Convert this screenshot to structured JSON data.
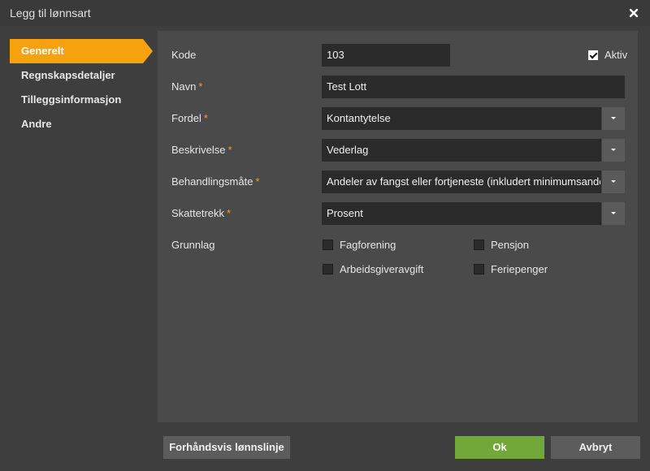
{
  "dialog": {
    "title": "Legg til lønnsart"
  },
  "sidebar": {
    "items": [
      {
        "label": "Generelt",
        "active": true
      },
      {
        "label": "Regnskapsdetaljer"
      },
      {
        "label": "Tilleggsinformasjon"
      },
      {
        "label": "Andre"
      }
    ]
  },
  "form": {
    "kode": {
      "label": "Kode",
      "value": "103"
    },
    "aktiv": {
      "label": "Aktiv",
      "checked": true
    },
    "navn": {
      "label": "Navn",
      "required_mark": "*",
      "value": "Test Lott"
    },
    "fordel": {
      "label": "Fordel",
      "required_mark": "*",
      "value": "Kontantytelse"
    },
    "beskrivelse": {
      "label": "Beskrivelse",
      "required_mark": "*",
      "value": "Vederlag"
    },
    "behandlingsmate": {
      "label": "Behandlingsmåte",
      "required_mark": "*",
      "value": "Andeler av fangst eller fortjeneste (inkludert minimumsandel) til"
    },
    "skattetrekk": {
      "label": "Skattetrekk",
      "required_mark": "*",
      "value": "Prosent"
    },
    "grunnlag": {
      "label": "Grunnlag",
      "options": [
        {
          "label": "Fagforening",
          "checked": false
        },
        {
          "label": "Pensjon",
          "checked": false
        },
        {
          "label": "Arbeidsgiveravgift",
          "checked": false
        },
        {
          "label": "Feriepenger",
          "checked": false
        }
      ]
    }
  },
  "footer": {
    "preview_label": "Forhåndsvis lønnslinje",
    "ok_label": "Ok",
    "cancel_label": "Avbryt"
  },
  "colors": {
    "accent": "#f5a20e",
    "ok": "#72a83a",
    "required": "#f59b2c"
  }
}
